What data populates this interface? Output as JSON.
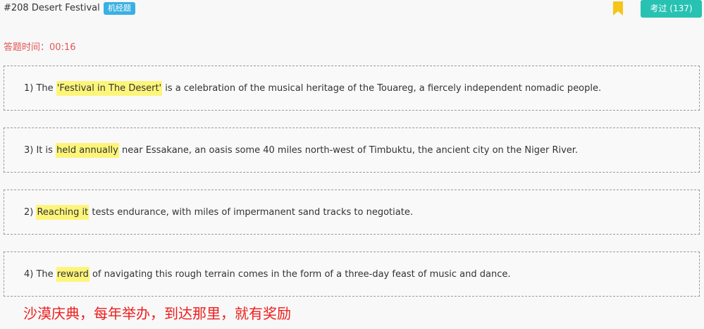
{
  "header": {
    "title": "#208 Desert Festival",
    "tag": "机经题",
    "exam_button": "考过 (137)",
    "bookmark_icon": "bookmark-icon",
    "bookmark_color": "#f5c518",
    "tag_color": "#3ab0e2",
    "exam_button_color": "#27c2b2"
  },
  "timer": {
    "label": "答题时间：",
    "value": "00:16"
  },
  "items": [
    {
      "pre": "1) The ",
      "highlight": "'Festival in The Desert'",
      "post": " is a celebration of the musical heritage of the Touareg, a fiercely independent nomadic people."
    },
    {
      "pre": "3) It is ",
      "highlight": "held annually",
      "post": " near Essakane, an oasis some 40 miles north-west of Timbuktu, the ancient city on the Niger River."
    },
    {
      "pre": "2) ",
      "highlight": "Reaching it",
      "post": " tests endurance, with miles of impermanent sand tracks to negotiate."
    },
    {
      "pre": "4) The ",
      "highlight": "reward",
      "post": " of navigating this rough terrain comes in the form of a three-day feast of music and dance."
    }
  ],
  "note": "沙漠庆典，每年举办，到达那里，就有奖励",
  "colors": {
    "highlight": "#fdf57a",
    "timer": "#e25656",
    "note": "#ee1c1c"
  }
}
